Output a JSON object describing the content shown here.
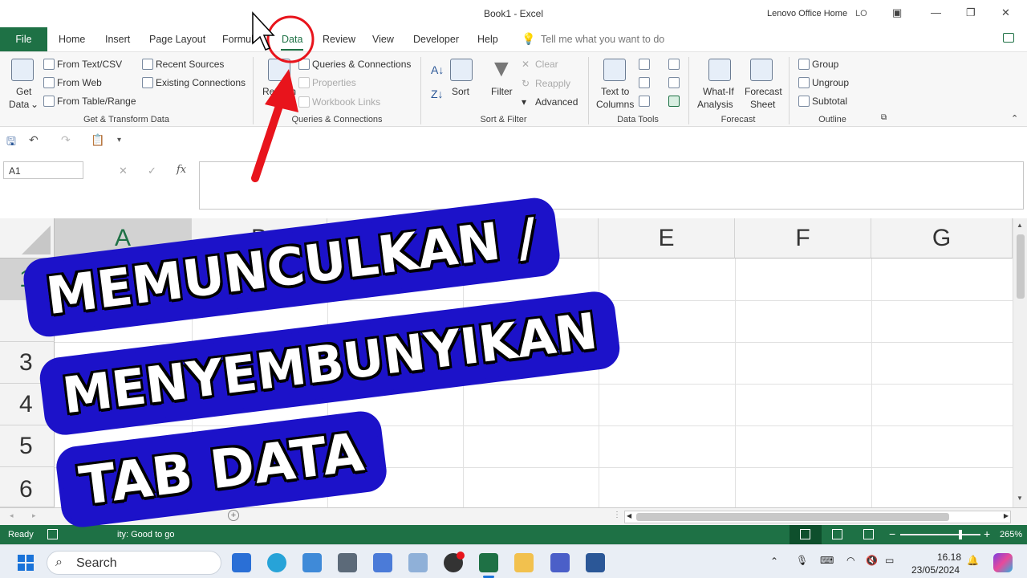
{
  "window": {
    "title": "Book1  -  Excel",
    "account": "Lenovo Office Home",
    "account_initials": "LO"
  },
  "tabs": {
    "file": "File",
    "items": [
      "Home",
      "Insert",
      "Page Layout",
      "Formulas",
      "Data",
      "Review",
      "View",
      "Developer",
      "Help"
    ],
    "active": "Data",
    "tell_me": "Tell me what you want to do"
  },
  "ribbon": {
    "get_transform": {
      "get_data_line1": "Get",
      "get_data_line2": "Data",
      "from_text_csv": "From Text/CSV",
      "from_web": "From Web",
      "from_table_range": "From Table/Range",
      "recent_sources": "Recent Sources",
      "existing_connections": "Existing Connections",
      "group_label": "Get & Transform Data"
    },
    "queries": {
      "refresh": "Refresh",
      "queries_connections": "Queries & Connections",
      "properties": "Properties",
      "workbook_links": "Workbook Links",
      "group_label": "Queries & Connections"
    },
    "sort_filter": {
      "sort": "Sort",
      "filter": "Filter",
      "clear": "Clear",
      "reapply": "Reapply",
      "advanced": "Advanced",
      "group_label": "Sort & Filter"
    },
    "data_tools": {
      "text_to_line1": "Text to",
      "text_to_line2": "Columns",
      "group_label": "Data Tools"
    },
    "forecast": {
      "what_if_line1": "What-If",
      "what_if_line2": "Analysis",
      "forecast_line1": "Forecast",
      "forecast_line2": "Sheet",
      "group_label": "Forecast"
    },
    "outline": {
      "group": "Group",
      "ungroup": "Ungroup",
      "subtotal": "Subtotal",
      "group_label": "Outline"
    }
  },
  "formula_bar": {
    "name_box": "A1",
    "fx": "fx"
  },
  "grid": {
    "columns": [
      "A",
      "B",
      "E",
      "F",
      "G"
    ],
    "rows": [
      "1",
      "3",
      "4",
      "5",
      "6"
    ]
  },
  "status": {
    "ready": "Ready",
    "accessibility": "ity: Good to go",
    "zoom": "265%"
  },
  "taskbar": {
    "search": "Search",
    "time": "16.18",
    "date": "23/05/2024"
  },
  "overlay": {
    "line1": "MEMUNCULKAN  /",
    "line2": "MENYEMBUNYIKAN",
    "line3": "TAB  DATA"
  },
  "colors": {
    "excel_green": "#1e7145",
    "overlay_blue": "#1c12c9",
    "annotation_red": "#e8141c"
  }
}
